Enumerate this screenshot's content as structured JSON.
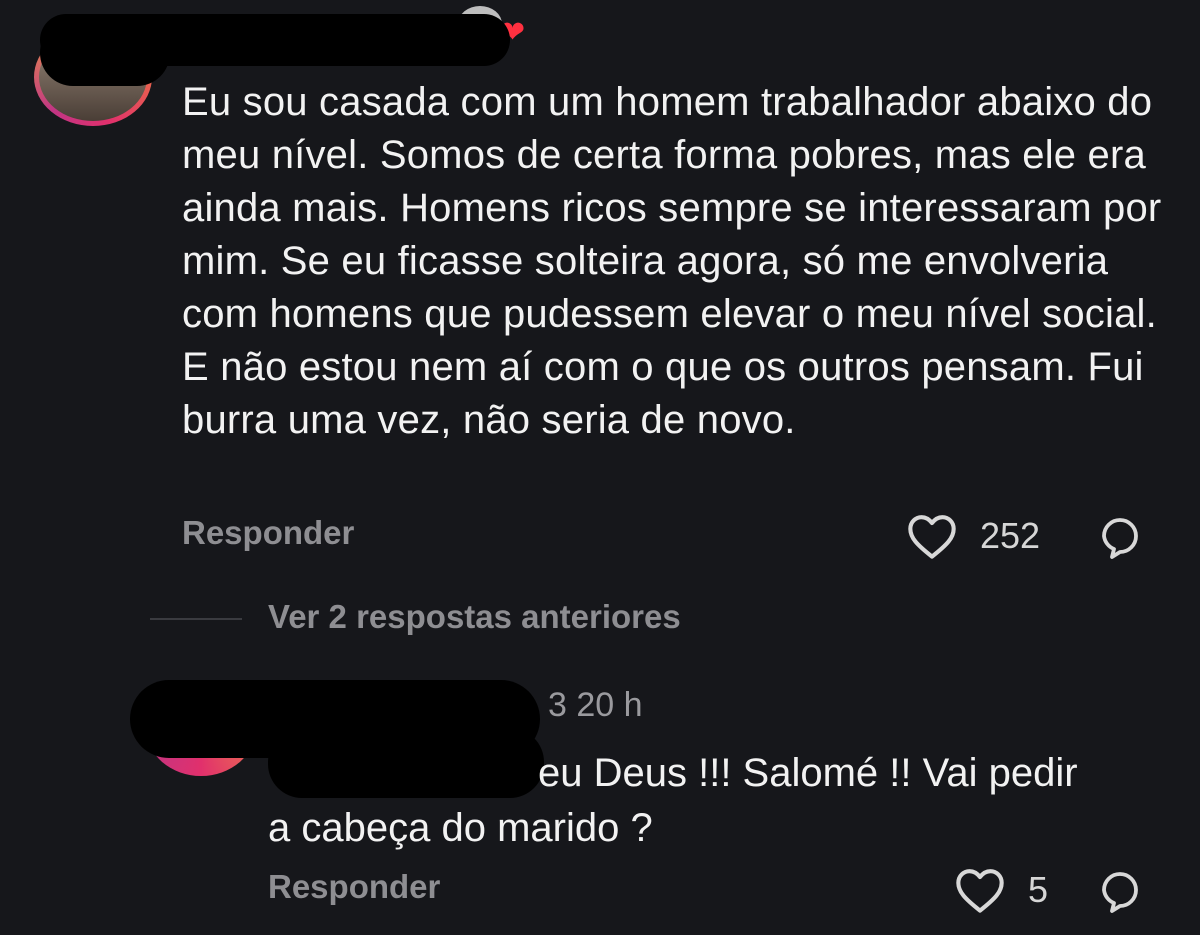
{
  "main_comment": {
    "text": "Eu sou casada com um homem trabalhador abaixo do meu nível. Somos de certa forma pobres, mas ele era ainda mais. Homens ricos sempre se interessaram por mim. Se eu ficasse solteira agora, só me envolveria com homens que pudessem elevar o meu nível social. E não estou nem aí com o que os outros pensam. Fui burra uma vez, não seria de novo.",
    "reply_label": "Responder",
    "like_count": "252"
  },
  "view_replies_label": "Ver 2 respostas anteriores",
  "reply_comment": {
    "timestamp": "3 20 h",
    "text_line1": "eu Deus !!! Salomé !! Vai pedir",
    "text_line2": "a cabeça do marido ?",
    "reply_label": "Responder",
    "like_count": "5"
  },
  "icons": {
    "like": "heart-outline-icon",
    "share": "share-bubble-icon",
    "author_like": "red-heart-icon"
  },
  "colors": {
    "background": "#16171b",
    "text": "#f2f2f2",
    "secondary": "#8e8e92",
    "heart": "#ff3040"
  }
}
